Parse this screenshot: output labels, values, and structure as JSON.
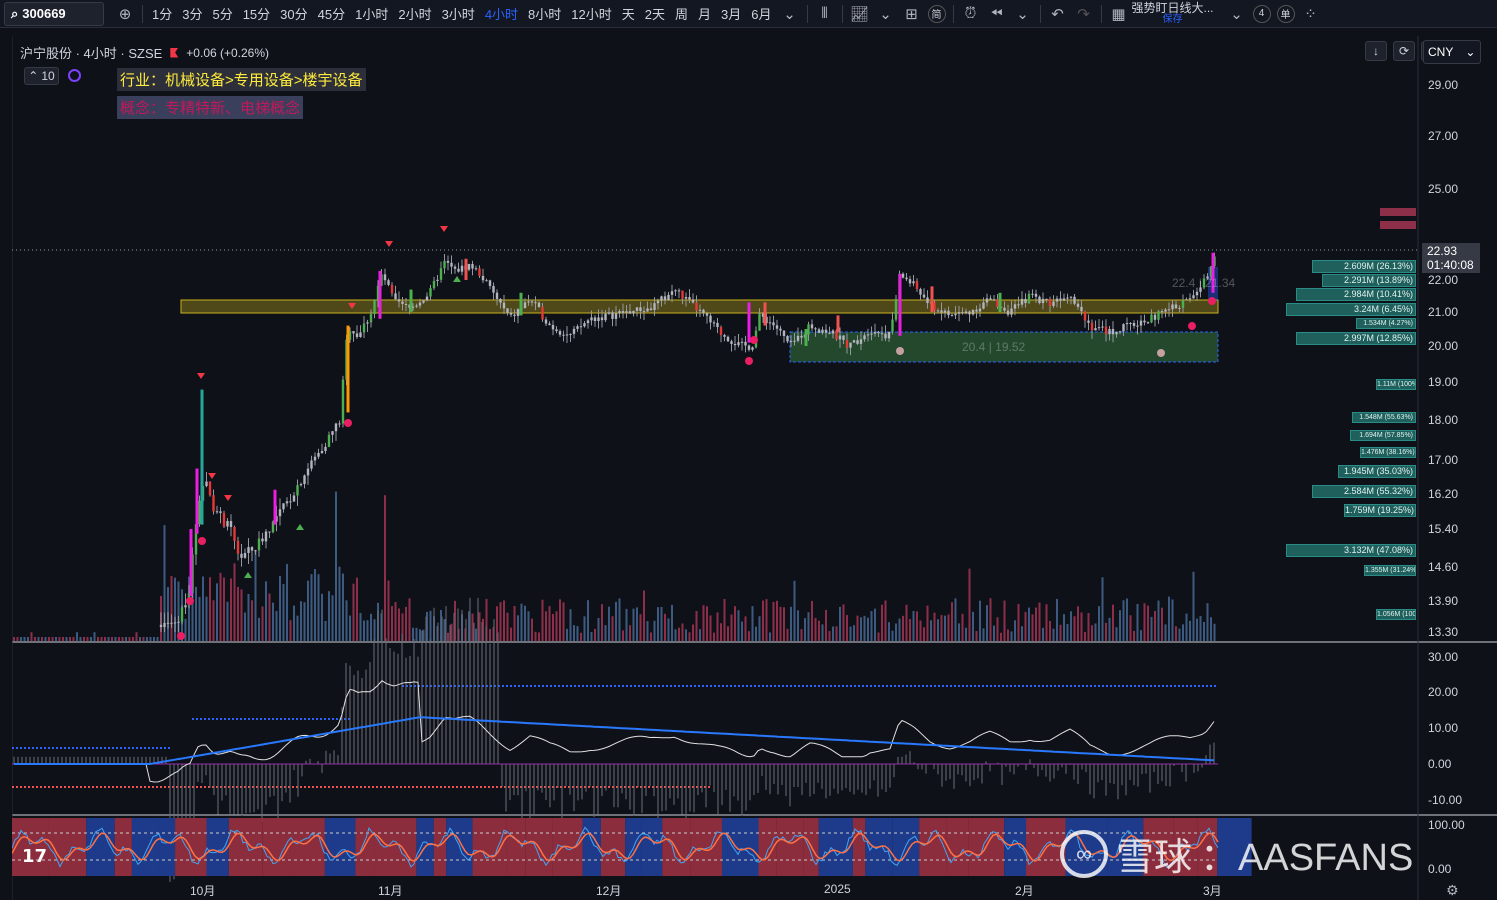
{
  "toolbar": {
    "symbol": "300669",
    "timeframes": [
      {
        "label": "1分",
        "active": false
      },
      {
        "label": "3分",
        "active": false
      },
      {
        "label": "5分",
        "active": false
      },
      {
        "label": "15分",
        "active": false
      },
      {
        "label": "30分",
        "active": false
      },
      {
        "label": "45分",
        "active": false
      },
      {
        "label": "1小时",
        "active": false
      },
      {
        "label": "2小时",
        "active": false
      },
      {
        "label": "3小时",
        "active": false
      },
      {
        "label": "4小时",
        "active": true
      },
      {
        "label": "8小时",
        "active": false
      },
      {
        "label": "12小时",
        "active": false
      },
      {
        "label": "天",
        "active": false
      },
      {
        "label": "2天",
        "active": false
      },
      {
        "label": "周",
        "active": false
      },
      {
        "label": "月",
        "active": false
      },
      {
        "label": "3月",
        "active": false
      },
      {
        "label": "6月",
        "active": false
      }
    ],
    "ind_label": "简",
    "layout_name": "强势盯日线大...",
    "layout_saved": "保存",
    "count_badge": "4",
    "single_label": "单"
  },
  "legend": {
    "title": "沪宁股份 · 4小时 · SZSE",
    "change": "+0.06 (+0.26%)",
    "indicator_count": "10"
  },
  "tags": {
    "industry": "行业：机械设备>专用设备>楼宇设备",
    "concept": "概念：专精特新、电梯概念"
  },
  "currency": "CNY",
  "price_axis": {
    "labels": [
      "29.00",
      "27.00",
      "25.00",
      "22.00",
      "21.00",
      "20.00",
      "19.00",
      "18.00",
      "17.00",
      "16.20",
      "15.40",
      "14.60",
      "13.90",
      "13.30"
    ],
    "current_price": "22.93",
    "countdown": "01:40:08"
  },
  "macd_axis": [
    "30.00",
    "20.00",
    "10.00",
    "0.00",
    "-10.00"
  ],
  "osc_axis": [
    "100.00",
    "0.00"
  ],
  "time_axis": [
    "10月",
    "11月",
    "12月",
    "2025",
    "2月",
    "3月"
  ],
  "zones": {
    "upper_text": "22.4 | 21.34",
    "lower_text": "20.4 | 19.52"
  },
  "volume_profile": [
    {
      "text": "2.609M (26.13%)"
    },
    {
      "text": "2.291M (13.89%)"
    },
    {
      "text": "2.984M (10.41%)"
    },
    {
      "text": "3.24M (6.45%)"
    },
    {
      "text": "1.534M (4.27%)"
    },
    {
      "text": "2.997M (12.85%)"
    },
    {
      "text": "1.11M (100%)"
    },
    {
      "text": "1.548M (55.63%)"
    },
    {
      "text": "1.694M (57.85%)"
    },
    {
      "text": "1.476M (38.16%)"
    },
    {
      "text": "1.945M (35.03%)"
    },
    {
      "text": "2.584M (55.32%)"
    },
    {
      "text": "1.759M (19.25%)"
    },
    {
      "text": "3.132M (47.08%)"
    },
    {
      "text": "1.355M (31.24%)"
    },
    {
      "text": "1.056M (100%)"
    }
  ],
  "watermark": {
    "site": "雪球",
    "user": "：AASFANS"
  },
  "colors": {
    "up": "#26a69a",
    "down": "#ef5350",
    "magenta": "#e91ee0",
    "orange": "#ff9800",
    "zone_yellow": "#c9b11e",
    "zone_green": "#4caf50",
    "macd_signal": "#2962ff",
    "osc_red": "#8b2d3c",
    "osc_blue": "#1e3a8a"
  }
}
